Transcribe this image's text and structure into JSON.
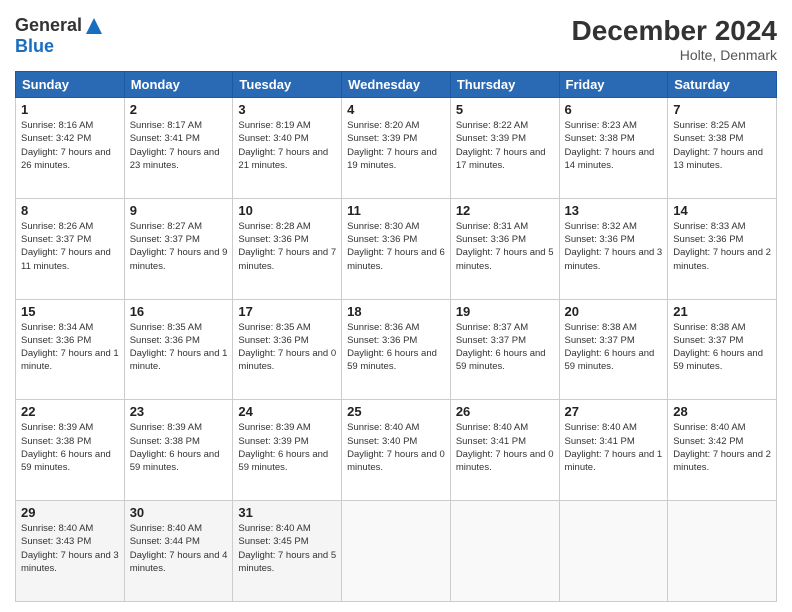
{
  "header": {
    "logo_general": "General",
    "logo_blue": "Blue",
    "month": "December 2024",
    "location": "Holte, Denmark"
  },
  "days_of_week": [
    "Sunday",
    "Monday",
    "Tuesday",
    "Wednesday",
    "Thursday",
    "Friday",
    "Saturday"
  ],
  "weeks": [
    [
      {
        "day": "1",
        "sunrise": "Sunrise: 8:16 AM",
        "sunset": "Sunset: 3:42 PM",
        "daylight": "Daylight: 7 hours and 26 minutes."
      },
      {
        "day": "2",
        "sunrise": "Sunrise: 8:17 AM",
        "sunset": "Sunset: 3:41 PM",
        "daylight": "Daylight: 7 hours and 23 minutes."
      },
      {
        "day": "3",
        "sunrise": "Sunrise: 8:19 AM",
        "sunset": "Sunset: 3:40 PM",
        "daylight": "Daylight: 7 hours and 21 minutes."
      },
      {
        "day": "4",
        "sunrise": "Sunrise: 8:20 AM",
        "sunset": "Sunset: 3:39 PM",
        "daylight": "Daylight: 7 hours and 19 minutes."
      },
      {
        "day": "5",
        "sunrise": "Sunrise: 8:22 AM",
        "sunset": "Sunset: 3:39 PM",
        "daylight": "Daylight: 7 hours and 17 minutes."
      },
      {
        "day": "6",
        "sunrise": "Sunrise: 8:23 AM",
        "sunset": "Sunset: 3:38 PM",
        "daylight": "Daylight: 7 hours and 14 minutes."
      },
      {
        "day": "7",
        "sunrise": "Sunrise: 8:25 AM",
        "sunset": "Sunset: 3:38 PM",
        "daylight": "Daylight: 7 hours and 13 minutes."
      }
    ],
    [
      {
        "day": "8",
        "sunrise": "Sunrise: 8:26 AM",
        "sunset": "Sunset: 3:37 PM",
        "daylight": "Daylight: 7 hours and 11 minutes."
      },
      {
        "day": "9",
        "sunrise": "Sunrise: 8:27 AM",
        "sunset": "Sunset: 3:37 PM",
        "daylight": "Daylight: 7 hours and 9 minutes."
      },
      {
        "day": "10",
        "sunrise": "Sunrise: 8:28 AM",
        "sunset": "Sunset: 3:36 PM",
        "daylight": "Daylight: 7 hours and 7 minutes."
      },
      {
        "day": "11",
        "sunrise": "Sunrise: 8:30 AM",
        "sunset": "Sunset: 3:36 PM",
        "daylight": "Daylight: 7 hours and 6 minutes."
      },
      {
        "day": "12",
        "sunrise": "Sunrise: 8:31 AM",
        "sunset": "Sunset: 3:36 PM",
        "daylight": "Daylight: 7 hours and 5 minutes."
      },
      {
        "day": "13",
        "sunrise": "Sunrise: 8:32 AM",
        "sunset": "Sunset: 3:36 PM",
        "daylight": "Daylight: 7 hours and 3 minutes."
      },
      {
        "day": "14",
        "sunrise": "Sunrise: 8:33 AM",
        "sunset": "Sunset: 3:36 PM",
        "daylight": "Daylight: 7 hours and 2 minutes."
      }
    ],
    [
      {
        "day": "15",
        "sunrise": "Sunrise: 8:34 AM",
        "sunset": "Sunset: 3:36 PM",
        "daylight": "Daylight: 7 hours and 1 minute."
      },
      {
        "day": "16",
        "sunrise": "Sunrise: 8:35 AM",
        "sunset": "Sunset: 3:36 PM",
        "daylight": "Daylight: 7 hours and 1 minute."
      },
      {
        "day": "17",
        "sunrise": "Sunrise: 8:35 AM",
        "sunset": "Sunset: 3:36 PM",
        "daylight": "Daylight: 7 hours and 0 minutes."
      },
      {
        "day": "18",
        "sunrise": "Sunrise: 8:36 AM",
        "sunset": "Sunset: 3:36 PM",
        "daylight": "Daylight: 6 hours and 59 minutes."
      },
      {
        "day": "19",
        "sunrise": "Sunrise: 8:37 AM",
        "sunset": "Sunset: 3:37 PM",
        "daylight": "Daylight: 6 hours and 59 minutes."
      },
      {
        "day": "20",
        "sunrise": "Sunrise: 8:38 AM",
        "sunset": "Sunset: 3:37 PM",
        "daylight": "Daylight: 6 hours and 59 minutes."
      },
      {
        "day": "21",
        "sunrise": "Sunrise: 8:38 AM",
        "sunset": "Sunset: 3:37 PM",
        "daylight": "Daylight: 6 hours and 59 minutes."
      }
    ],
    [
      {
        "day": "22",
        "sunrise": "Sunrise: 8:39 AM",
        "sunset": "Sunset: 3:38 PM",
        "daylight": "Daylight: 6 hours and 59 minutes."
      },
      {
        "day": "23",
        "sunrise": "Sunrise: 8:39 AM",
        "sunset": "Sunset: 3:38 PM",
        "daylight": "Daylight: 6 hours and 59 minutes."
      },
      {
        "day": "24",
        "sunrise": "Sunrise: 8:39 AM",
        "sunset": "Sunset: 3:39 PM",
        "daylight": "Daylight: 6 hours and 59 minutes."
      },
      {
        "day": "25",
        "sunrise": "Sunrise: 8:40 AM",
        "sunset": "Sunset: 3:40 PM",
        "daylight": "Daylight: 7 hours and 0 minutes."
      },
      {
        "day": "26",
        "sunrise": "Sunrise: 8:40 AM",
        "sunset": "Sunset: 3:41 PM",
        "daylight": "Daylight: 7 hours and 0 minutes."
      },
      {
        "day": "27",
        "sunrise": "Sunrise: 8:40 AM",
        "sunset": "Sunset: 3:41 PM",
        "daylight": "Daylight: 7 hours and 1 minute."
      },
      {
        "day": "28",
        "sunrise": "Sunrise: 8:40 AM",
        "sunset": "Sunset: 3:42 PM",
        "daylight": "Daylight: 7 hours and 2 minutes."
      }
    ],
    [
      {
        "day": "29",
        "sunrise": "Sunrise: 8:40 AM",
        "sunset": "Sunset: 3:43 PM",
        "daylight": "Daylight: 7 hours and 3 minutes."
      },
      {
        "day": "30",
        "sunrise": "Sunrise: 8:40 AM",
        "sunset": "Sunset: 3:44 PM",
        "daylight": "Daylight: 7 hours and 4 minutes."
      },
      {
        "day": "31",
        "sunrise": "Sunrise: 8:40 AM",
        "sunset": "Sunset: 3:45 PM",
        "daylight": "Daylight: 7 hours and 5 minutes."
      },
      null,
      null,
      null,
      null
    ]
  ]
}
